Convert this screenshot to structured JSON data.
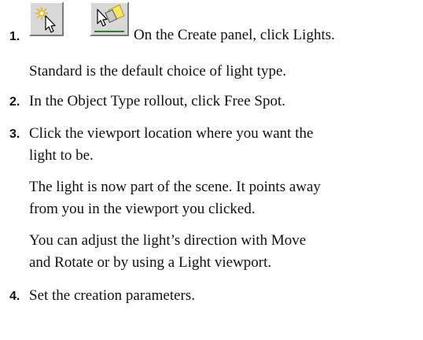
{
  "steps": [
    {
      "number": "1.",
      "icons": [
        "light-arrow-sparkle-icon",
        "light-arrow-flashlight-icon"
      ],
      "text": "On the Create panel, click Lights.",
      "notes": [
        "Standard is the default choice of light type."
      ]
    },
    {
      "number": "2.",
      "text": "In the Object Type rollout, click Free Spot."
    },
    {
      "number": "3.",
      "text_lines": [
        "Click the viewport location where you want the",
        "light to be."
      ],
      "notes": [
        [
          "The light is now part of the scene. It points away",
          "from you in the viewport you clicked."
        ],
        [
          "You can adjust the light’s direction with Move",
          "and Rotate or by using a Light viewport."
        ]
      ]
    },
    {
      "number": "4.",
      "text": "Set the creation parameters."
    }
  ]
}
